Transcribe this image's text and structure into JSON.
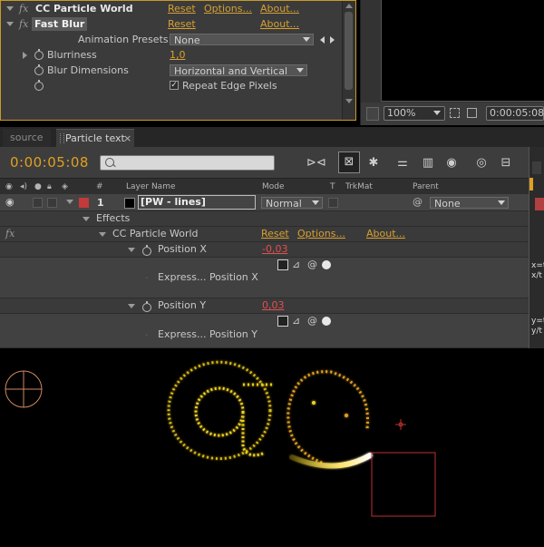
{
  "effect_controls": {
    "cc_particle_world": {
      "name": "CC Particle World",
      "reset": "Reset",
      "options": "Options...",
      "about": "About..."
    },
    "fast_blur": {
      "name": "Fast Blur",
      "reset": "Reset",
      "about": "About..."
    },
    "animation_presets": {
      "label": "Animation Presets:",
      "value": "None"
    },
    "blurriness": {
      "label": "Blurriness",
      "value": "1,0"
    },
    "blur_dimensions": {
      "label": "Blur Dimensions",
      "value": "Horizontal and Vertical"
    },
    "repeat_edge_pixels": {
      "label": "Repeat Edge Pixels",
      "checked": true,
      "check_glyph": "✓"
    },
    "fx_badge": "fx"
  },
  "viewer": {
    "zoom": "100%",
    "timecode": "0:00:05:08"
  },
  "tabs": [
    {
      "label": "source",
      "active": false
    },
    {
      "label": "Particle text",
      "active": true,
      "close": "×"
    }
  ],
  "timeline": {
    "timecode": "0:00:05:08",
    "search_placeholder": "",
    "columns": {
      "hash": "#",
      "layer_name": "Layer Name",
      "mode": "Mode",
      "t": "T",
      "trkmat": "TrkMat",
      "parent": "Parent"
    },
    "layer": {
      "number": "1",
      "name": "[PW - lines]",
      "mode": "Normal",
      "parent": "None",
      "label_color": "#c23a3a"
    },
    "effects_label": "Effects",
    "effect": {
      "name": "CC Particle World",
      "reset": "Reset",
      "options": "Options...",
      "about": "About..."
    },
    "position_x": {
      "label": "Position X",
      "value": "-0,03",
      "expression_label": "Express... Position X",
      "expr_text_1": "x=t",
      "expr_text_2": "x/t"
    },
    "position_y": {
      "label": "Position Y",
      "value": "0,03",
      "expression_label": "Express... Position Y",
      "expr_text_1": "y=t",
      "expr_text_2": "y/t"
    }
  },
  "colors": {
    "accent_orange": "#d8a030",
    "timecode_orange": "#e0a020",
    "value_red": "#e05050",
    "particle_yellow": "#f0d020",
    "panel_bg": "#3b3b3b"
  }
}
